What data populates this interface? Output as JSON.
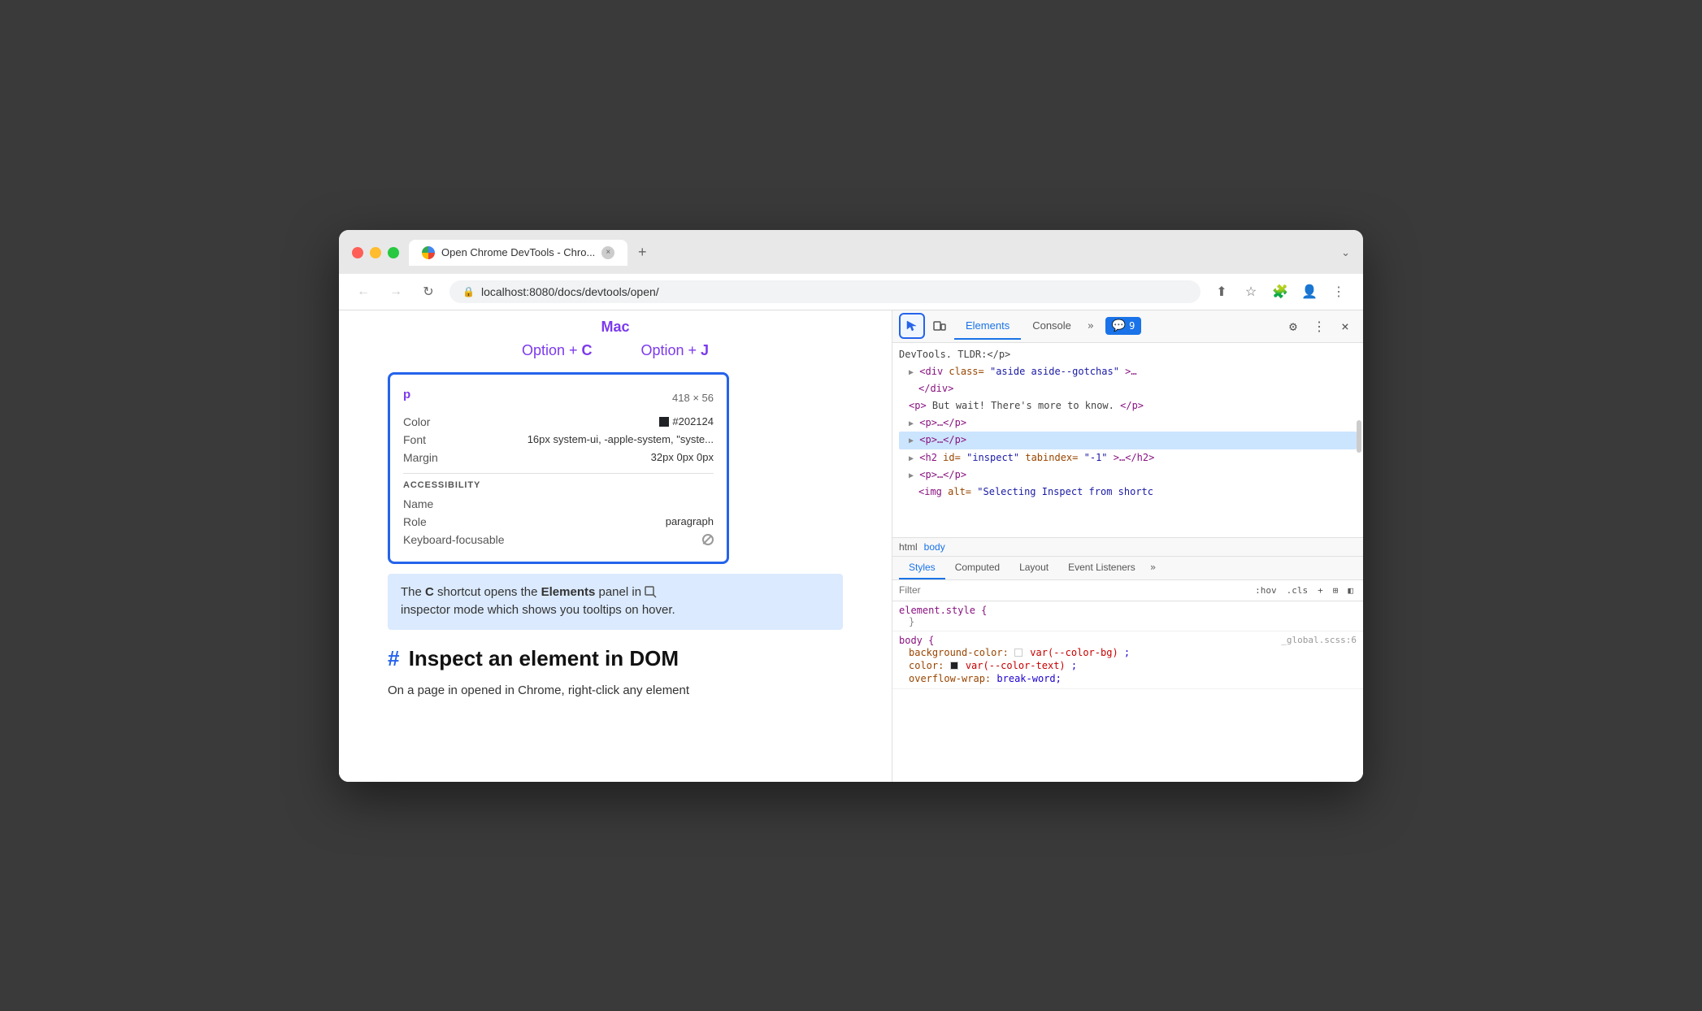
{
  "window": {
    "title": "Open Chrome DevTools - Chro...",
    "url": "localhost:8080/docs/devtools/open/",
    "tab_close": "×",
    "tab_new": "+",
    "tab_menu": "⌄"
  },
  "nav": {
    "back": "←",
    "forward": "→",
    "refresh": "↻",
    "share": "⬆",
    "star": "☆",
    "extension": "🧩",
    "profile": "👤",
    "menu": "⋮"
  },
  "webpage": {
    "mac_label": "Mac",
    "shortcut_c": "Option + C",
    "shortcut_j": "Option + J",
    "tooltip": {
      "tag": "p",
      "size": "418 × 56",
      "color_label": "Color",
      "color_value": "#202124",
      "font_label": "Font",
      "font_value": "16px system-ui, -apple-system, \"syste...",
      "margin_label": "Margin",
      "margin_value": "32px 0px 0px",
      "accessibility_heading": "ACCESSIBILITY",
      "name_label": "Name",
      "name_value": "",
      "role_label": "Role",
      "role_value": "paragraph",
      "keyboard_label": "Keyboard-focusable"
    },
    "highlight": {
      "text_before": "The ",
      "key_c": "C",
      "text_mid": " shortcut opens the ",
      "elements": "Elements",
      "text_after": " panel in",
      "text2": "inspector mode which shows you tooltips on hover."
    },
    "heading": "Inspect an element in DOM",
    "body_text": "On a page in opened in Chrome, right-click any element"
  },
  "devtools": {
    "tabs": [
      "Elements",
      "Console"
    ],
    "more_tabs": "»",
    "notification_icon": "💬",
    "notification_count": "9",
    "settings_label": "⚙",
    "more_label": "⋮",
    "close_label": "×",
    "dom": {
      "lines": [
        {
          "indent": 0,
          "content": "DevTools. TLDR:</p>",
          "selected": false
        },
        {
          "indent": 1,
          "content": "▶ <div class=\"aside aside--gotchas\">…",
          "selected": false
        },
        {
          "indent": 2,
          "content": "</div>",
          "selected": false
        },
        {
          "indent": 1,
          "content": "<p>But wait! There's more to know.</p>",
          "selected": false
        },
        {
          "indent": 1,
          "content": "▶ <p>…</p>",
          "selected": false
        },
        {
          "indent": 1,
          "content": "▶ <p>…</p>",
          "selected": true
        },
        {
          "indent": 1,
          "content": "▶ <h2 id=\"inspect\" tabindex=\"-1\">…</h2>",
          "selected": false
        },
        {
          "indent": 1,
          "content": "▶ <p>…</p>",
          "selected": false
        },
        {
          "indent": 2,
          "content": "<img alt=\"Selecting Inspect from shortc",
          "selected": false
        }
      ]
    },
    "breadcrumb": {
      "html": "html",
      "body": "body"
    },
    "styles_tabs": [
      "Styles",
      "Computed",
      "Layout",
      "Event Listeners"
    ],
    "styles_more": "»",
    "filter_placeholder": "Filter",
    "filter_hov": ":hov",
    "filter_cls": ".cls",
    "filter_plus": "+",
    "filter_layers": "⊞",
    "filter_toggle": "◧",
    "css_blocks": [
      {
        "selector": "element.style {",
        "close": "}",
        "source": "",
        "properties": []
      },
      {
        "selector": "body {",
        "close": "}",
        "source": "_global.scss:6",
        "properties": [
          {
            "name": "background-color:",
            "value": "var(--color-bg);",
            "has_swatch": true,
            "swatch_color": "#ffffff"
          },
          {
            "name": "color:",
            "value": "var(--color-text);",
            "has_swatch": true,
            "swatch_color": "#202124"
          },
          {
            "name": "overflow-wrap:",
            "value": "break-word;"
          }
        ]
      }
    ]
  }
}
